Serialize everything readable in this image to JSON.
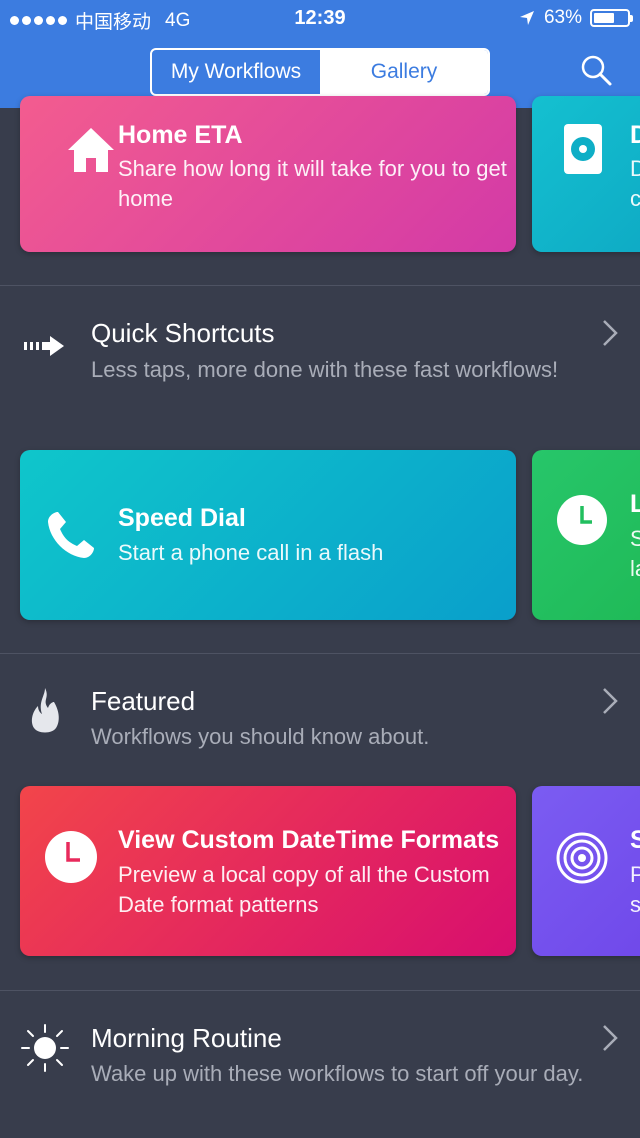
{
  "status_bar": {
    "carrier": "中国移动",
    "network": "4G",
    "time": "12:39",
    "battery": "63%",
    "battery_level": 0.63
  },
  "nav": {
    "tabs": [
      {
        "label": "My Workflows"
      },
      {
        "label": "Gallery"
      }
    ],
    "active_tab": "Gallery",
    "search_icon": "search-icon"
  },
  "sections": [
    {
      "cards": [
        {
          "title": "Home ETA",
          "description": "Share how long it will take for you to get home",
          "icon": "house-icon",
          "gradient": [
            "#f35c8f",
            "#d33aa7"
          ]
        },
        {
          "title": "D",
          "description": "D c",
          "icon": "disk-icon",
          "gradient": [
            "#14c0d0",
            "#0ea9c4"
          ]
        }
      ]
    },
    {
      "title": "Quick Shortcuts",
      "description": "Less taps, more done with these fast workflows!",
      "icon": "arrow-right-icon",
      "cards": [
        {
          "title": "Speed Dial",
          "description": "Start a phone call in a flash",
          "icon": "phone-icon",
          "gradient": [
            "#0fc6cb",
            "#0a9fcb"
          ]
        },
        {
          "title": "L",
          "description": "S la",
          "icon": "clock-icon",
          "gradient": [
            "#27c66a",
            "#1fb956"
          ]
        }
      ]
    },
    {
      "title": "Featured",
      "description": "Workflows you should know about.",
      "icon": "flame-icon",
      "cards": [
        {
          "title": "View Custom DateTime Formats",
          "description": "Preview a local copy of all the Custom Date format patterns",
          "icon": "clock-icon",
          "gradient": [
            "#f2454a",
            "#d80e6f"
          ]
        },
        {
          "title": "S",
          "description": "P s",
          "icon": "target-icon",
          "gradient": [
            "#7b5cf2",
            "#6f47e9"
          ]
        }
      ]
    },
    {
      "title": "Morning Routine",
      "description": "Wake up with these workflows to start off your day.",
      "icon": "sun-icon"
    }
  ],
  "colors": {
    "header": "#3c7ce0",
    "background": "#383d4c",
    "secondary_text": "#a9adb8"
  }
}
